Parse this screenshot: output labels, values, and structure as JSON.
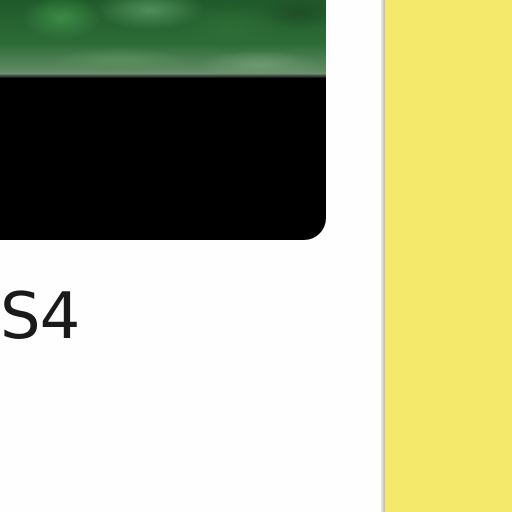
{
  "card": {
    "title": "S4",
    "thumbnail": "foliage-image"
  },
  "side_panel": {
    "color": "#f4e96b"
  }
}
